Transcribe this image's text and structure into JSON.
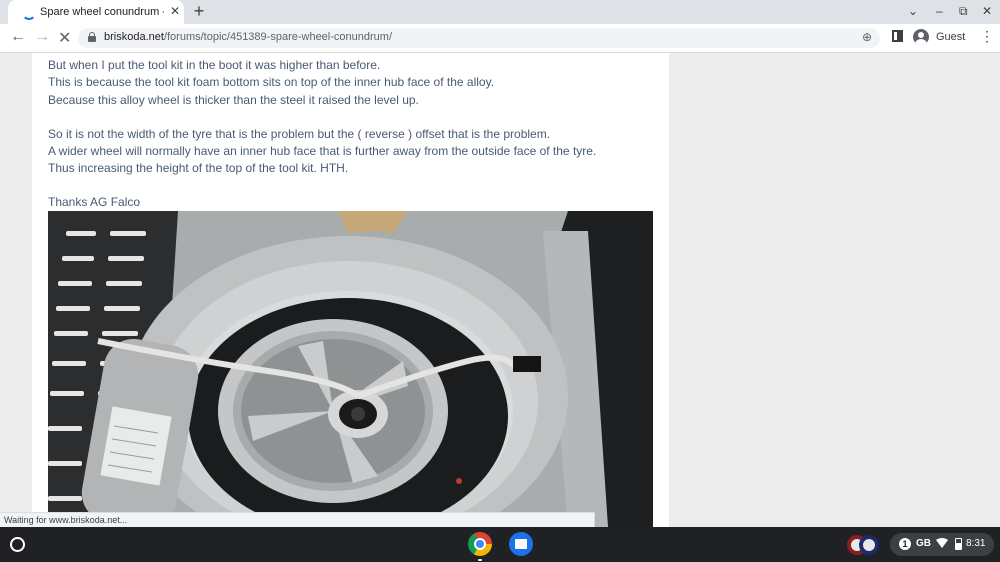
{
  "tab": {
    "title": "Spare wheel conundrum - Skoda",
    "close": "✕"
  },
  "new_tab": "+",
  "window_controls": {
    "tab_search": "⌄",
    "minimize": "–",
    "restore": "⧉",
    "close": "✕"
  },
  "nav": {
    "back": "←",
    "forward": "→",
    "stop": "✕"
  },
  "address": {
    "host": "briskoda.net",
    "path": "/forums/topic/451389-spare-wheel-conundrum/"
  },
  "toolbar": {
    "zoom_icon": "⊕",
    "profile_label": "Guest",
    "menu": "⋮"
  },
  "post": {
    "lines": [
      "But when I put the tool kit in the boot it was higher than before.",
      "This is because the tool kit foam bottom sits on top of the inner hub face of the alloy.",
      "Because this alloy wheel is thicker than the steel it raised the level up.",
      "So it is not the width of the tyre that is the problem but the ( reverse ) offset that is the problem.",
      "A wider wheel will normally have an inner hub face that is further away from the outside face of the tyre.",
      "Thus increasing the height of the top of the tool kit.  HTH."
    ],
    "signoff": "Thanks AG Falco"
  },
  "status_bar": "Waiting for www.briskoda.net...",
  "shelf": {
    "tray_badge": "1",
    "network": "GB",
    "time": "8:31"
  },
  "colors": {
    "link_text": "#4a5a73",
    "accent": "#1a73e8"
  }
}
